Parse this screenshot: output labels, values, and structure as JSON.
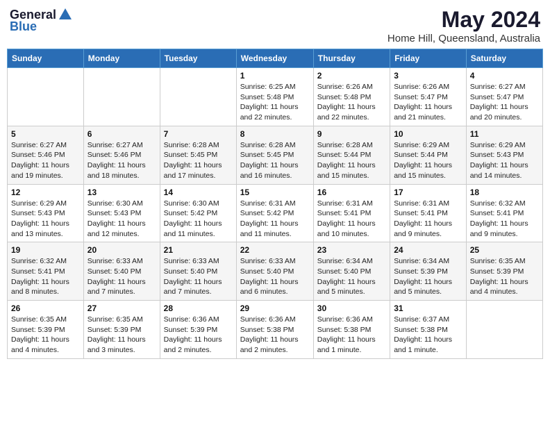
{
  "logo": {
    "general": "General",
    "blue": "Blue"
  },
  "title": "May 2024",
  "location": "Home Hill, Queensland, Australia",
  "days_header": [
    "Sunday",
    "Monday",
    "Tuesday",
    "Wednesday",
    "Thursday",
    "Friday",
    "Saturday"
  ],
  "weeks": [
    [
      {
        "day": "",
        "sunrise": "",
        "sunset": "",
        "daylight": ""
      },
      {
        "day": "",
        "sunrise": "",
        "sunset": "",
        "daylight": ""
      },
      {
        "day": "",
        "sunrise": "",
        "sunset": "",
        "daylight": ""
      },
      {
        "day": "1",
        "sunrise": "6:25 AM",
        "sunset": "5:48 PM",
        "daylight": "11 hours and 22 minutes."
      },
      {
        "day": "2",
        "sunrise": "6:26 AM",
        "sunset": "5:48 PM",
        "daylight": "11 hours and 22 minutes."
      },
      {
        "day": "3",
        "sunrise": "6:26 AM",
        "sunset": "5:47 PM",
        "daylight": "11 hours and 21 minutes."
      },
      {
        "day": "4",
        "sunrise": "6:27 AM",
        "sunset": "5:47 PM",
        "daylight": "11 hours and 20 minutes."
      }
    ],
    [
      {
        "day": "5",
        "sunrise": "6:27 AM",
        "sunset": "5:46 PM",
        "daylight": "11 hours and 19 minutes."
      },
      {
        "day": "6",
        "sunrise": "6:27 AM",
        "sunset": "5:46 PM",
        "daylight": "11 hours and 18 minutes."
      },
      {
        "day": "7",
        "sunrise": "6:28 AM",
        "sunset": "5:45 PM",
        "daylight": "11 hours and 17 minutes."
      },
      {
        "day": "8",
        "sunrise": "6:28 AM",
        "sunset": "5:45 PM",
        "daylight": "11 hours and 16 minutes."
      },
      {
        "day": "9",
        "sunrise": "6:28 AM",
        "sunset": "5:44 PM",
        "daylight": "11 hours and 15 minutes."
      },
      {
        "day": "10",
        "sunrise": "6:29 AM",
        "sunset": "5:44 PM",
        "daylight": "11 hours and 15 minutes."
      },
      {
        "day": "11",
        "sunrise": "6:29 AM",
        "sunset": "5:43 PM",
        "daylight": "11 hours and 14 minutes."
      }
    ],
    [
      {
        "day": "12",
        "sunrise": "6:29 AM",
        "sunset": "5:43 PM",
        "daylight": "11 hours and 13 minutes."
      },
      {
        "day": "13",
        "sunrise": "6:30 AM",
        "sunset": "5:43 PM",
        "daylight": "11 hours and 12 minutes."
      },
      {
        "day": "14",
        "sunrise": "6:30 AM",
        "sunset": "5:42 PM",
        "daylight": "11 hours and 11 minutes."
      },
      {
        "day": "15",
        "sunrise": "6:31 AM",
        "sunset": "5:42 PM",
        "daylight": "11 hours and 11 minutes."
      },
      {
        "day": "16",
        "sunrise": "6:31 AM",
        "sunset": "5:41 PM",
        "daylight": "11 hours and 10 minutes."
      },
      {
        "day": "17",
        "sunrise": "6:31 AM",
        "sunset": "5:41 PM",
        "daylight": "11 hours and 9 minutes."
      },
      {
        "day": "18",
        "sunrise": "6:32 AM",
        "sunset": "5:41 PM",
        "daylight": "11 hours and 9 minutes."
      }
    ],
    [
      {
        "day": "19",
        "sunrise": "6:32 AM",
        "sunset": "5:41 PM",
        "daylight": "11 hours and 8 minutes."
      },
      {
        "day": "20",
        "sunrise": "6:33 AM",
        "sunset": "5:40 PM",
        "daylight": "11 hours and 7 minutes."
      },
      {
        "day": "21",
        "sunrise": "6:33 AM",
        "sunset": "5:40 PM",
        "daylight": "11 hours and 7 minutes."
      },
      {
        "day": "22",
        "sunrise": "6:33 AM",
        "sunset": "5:40 PM",
        "daylight": "11 hours and 6 minutes."
      },
      {
        "day": "23",
        "sunrise": "6:34 AM",
        "sunset": "5:40 PM",
        "daylight": "11 hours and 5 minutes."
      },
      {
        "day": "24",
        "sunrise": "6:34 AM",
        "sunset": "5:39 PM",
        "daylight": "11 hours and 5 minutes."
      },
      {
        "day": "25",
        "sunrise": "6:35 AM",
        "sunset": "5:39 PM",
        "daylight": "11 hours and 4 minutes."
      }
    ],
    [
      {
        "day": "26",
        "sunrise": "6:35 AM",
        "sunset": "5:39 PM",
        "daylight": "11 hours and 4 minutes."
      },
      {
        "day": "27",
        "sunrise": "6:35 AM",
        "sunset": "5:39 PM",
        "daylight": "11 hours and 3 minutes."
      },
      {
        "day": "28",
        "sunrise": "6:36 AM",
        "sunset": "5:39 PM",
        "daylight": "11 hours and 2 minutes."
      },
      {
        "day": "29",
        "sunrise": "6:36 AM",
        "sunset": "5:38 PM",
        "daylight": "11 hours and 2 minutes."
      },
      {
        "day": "30",
        "sunrise": "6:36 AM",
        "sunset": "5:38 PM",
        "daylight": "11 hours and 1 minute."
      },
      {
        "day": "31",
        "sunrise": "6:37 AM",
        "sunset": "5:38 PM",
        "daylight": "11 hours and 1 minute."
      },
      {
        "day": "",
        "sunrise": "",
        "sunset": "",
        "daylight": ""
      }
    ]
  ],
  "labels": {
    "sunrise": "Sunrise:",
    "sunset": "Sunset:",
    "daylight": "Daylight:"
  }
}
